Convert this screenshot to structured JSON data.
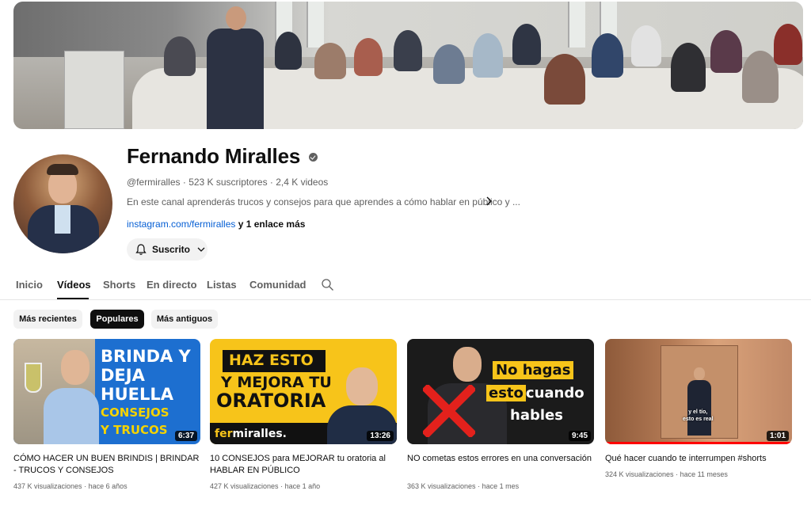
{
  "channel": {
    "name": "Fernando Miralles",
    "meta": "@fermiralles · 523 K suscriptores · 2,4 K videos",
    "description": "En este canal aprenderás trucos y consejos para que aprendes a cómo hablar en público y ...",
    "link": "instagram.com/fermiralles",
    "more_links": " y 1 enlace más",
    "subscribe_label": "Suscrito"
  },
  "tabs": [
    {
      "label": "Inicio",
      "active": false
    },
    {
      "label": "Vídeos",
      "active": true
    },
    {
      "label": "Shorts",
      "active": false
    },
    {
      "label": "En directo",
      "active": false
    },
    {
      "label": "Listas",
      "active": false
    },
    {
      "label": "Comunidad",
      "active": false
    }
  ],
  "chips": [
    {
      "label": "Más recientes",
      "active": false
    },
    {
      "label": "Populares",
      "active": true
    },
    {
      "label": "Más antiguos",
      "active": false
    }
  ],
  "videos": [
    {
      "title": "CÓMO HACER UN BUEN BRINDIS | BRINDAR - TRUCOS Y CONSEJOS",
      "views": "437 K visualizaciones",
      "age": "hace 6 años",
      "duration": "6:37",
      "thumb_text": {
        "l1": "BRINDA Y",
        "l2": "DEJA",
        "l3": "HUELLA",
        "l4": "CONSEJOS",
        "l5": "Y TRUCOS"
      }
    },
    {
      "title": "10 CONSEJOS para MEJORAR tu oratoria al HABLAR EN PÚBLICO",
      "views": "427 K visualizaciones",
      "age": "hace 1 año",
      "duration": "13:26",
      "thumb_text": {
        "l1": "HAZ ESTO",
        "l2": "Y MEJORA TU",
        "l3": "ORATORIA",
        "brand_a": "fer",
        "brand_b": "miralles."
      }
    },
    {
      "title": "NO cometas estos errores en una conversación",
      "views": "363 K visualizaciones",
      "age": "hace 1 mes",
      "duration": "9:45",
      "thumb_text": {
        "l1": "No hagas",
        "l2": "esto",
        "l2b": "cuando",
        "l3": "hables"
      }
    },
    {
      "title": "Qué hacer cuando te interrumpen #shorts",
      "views": "324 K visualizaciones",
      "age": "hace 11 meses",
      "duration": "1:01",
      "watched_fraction": 1.0,
      "thumb_text": {
        "l1": "y el tío,",
        "l2": "esto es real"
      }
    }
  ],
  "colors": {
    "link": "#065fd4",
    "accent_yellow": "#f7c41a",
    "accent_blue": "#1d6fd0",
    "progress": "#ff0000"
  }
}
